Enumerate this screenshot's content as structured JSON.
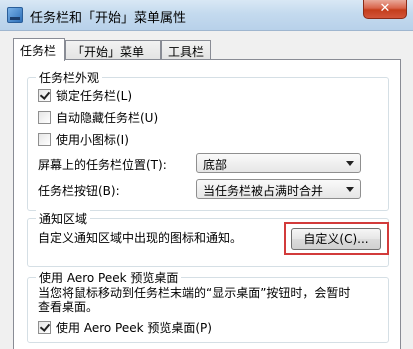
{
  "window": {
    "title": "任务栏和「开始」菜单属性",
    "close_glyph": "✕"
  },
  "tabs": [
    {
      "label": "任务栏"
    },
    {
      "label": "「开始」菜单"
    },
    {
      "label": "工具栏"
    }
  ],
  "appearance": {
    "title": "任务栏外观",
    "lock_taskbar": {
      "label": "锁定任务栏(L)",
      "checked": true
    },
    "auto_hide": {
      "label": "自动隐藏任务栏(U)",
      "checked": false
    },
    "small_icons": {
      "label": "使用小图标(I)",
      "checked": false
    },
    "location_label": "屏幕上的任务栏位置(T):",
    "location_value": "底部",
    "buttons_label": "任务栏按钮(B):",
    "buttons_value": "当任务栏被占满时合并"
  },
  "notification": {
    "title": "通知区域",
    "description": "自定义通知区域中出现的图标和通知。",
    "customize_button": "自定义(C)...",
    "highlight_color": "#d23b3b"
  },
  "aero_peek": {
    "title": "使用 Aero Peek 预览桌面",
    "description_line1": "当您将鼠标移动到任务栏末端的“显示桌面”按钮时，会暂时",
    "description_line2": "查看桌面。",
    "checkbox": {
      "label": "使用 Aero Peek 预览桌面(P)",
      "checked": true
    }
  }
}
